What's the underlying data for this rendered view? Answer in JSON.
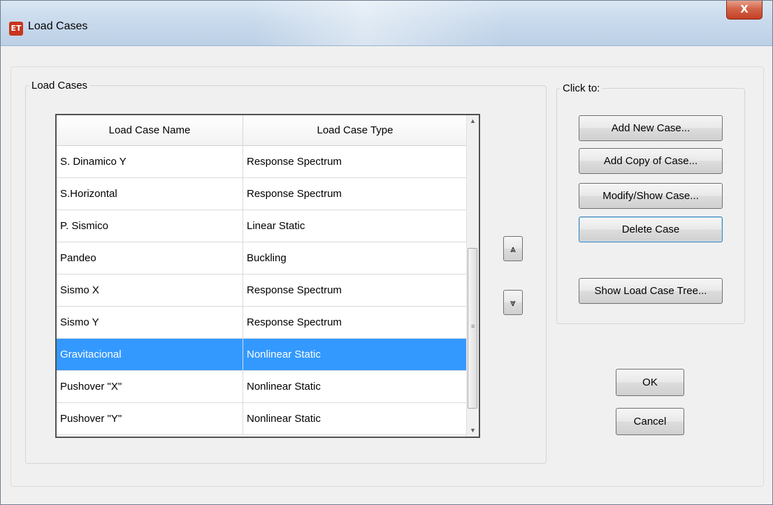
{
  "window": {
    "title": "Load Cases",
    "app_icon_text": "ET",
    "close_label": "X"
  },
  "load_cases_group": {
    "legend": "Load Cases",
    "columns": [
      "Load Case Name",
      "Load Case Type"
    ],
    "rows": [
      {
        "name": "S. Dinamico Y",
        "type": "Response Spectrum"
      },
      {
        "name": "S.Horizontal",
        "type": "Response Spectrum"
      },
      {
        "name": "P. Sismico",
        "type": "Linear Static"
      },
      {
        "name": "Pandeo",
        "type": "Buckling"
      },
      {
        "name": "Sismo X",
        "type": "Response Spectrum"
      },
      {
        "name": "Sismo Y",
        "type": "Response Spectrum"
      },
      {
        "name": "Gravitacional",
        "type": "Nonlinear Static",
        "selected": true
      },
      {
        "name": "Pushover \"X\"",
        "type": "Nonlinear Static"
      },
      {
        "name": "Pushover \"Y\"",
        "type": "Nonlinear Static"
      }
    ],
    "move_up_icon": "double-chevron-up-icon",
    "move_down_icon": "double-chevron-down-icon"
  },
  "click_to_group": {
    "legend": "Click to:",
    "add_new": "Add New Case...",
    "add_copy": "Add Copy of Case...",
    "modify": "Modify/Show Case...",
    "delete": "Delete Case",
    "show_tree": "Show Load Case Tree..."
  },
  "dialog_buttons": {
    "ok": "OK",
    "cancel": "Cancel"
  },
  "colors": {
    "selection": "#3399ff",
    "title_bar": "#c9daec",
    "close_button": "#c33f23"
  }
}
